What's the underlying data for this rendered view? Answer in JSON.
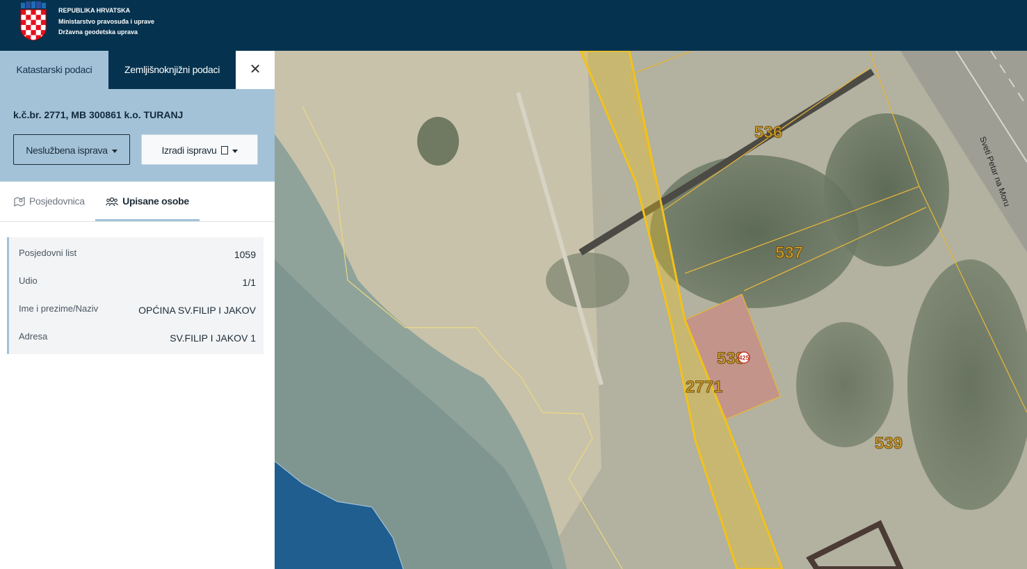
{
  "header": {
    "org_line1": "REPUBLIKA HRVATSKA",
    "org_line2": "Ministarstvo pravosuđa i uprave",
    "org_line3": "Državna geodetska uprava"
  },
  "panel": {
    "tabs": {
      "katastarski": "Katastarski podaci",
      "zemljisnoknjizni": "Zemljišnoknjižni podaci",
      "close": "✕"
    },
    "parcel_title": "k.č.br. 2771, MB 300861 k.o. TURANJ",
    "buttons": {
      "nesluzbena": "Neslužbena isprava",
      "izradi": "Izradi ispravu"
    },
    "subtabs": {
      "posjedovnica": "Posjedovnica",
      "upisane": "Upisane osobe"
    },
    "owner_rows": [
      {
        "label": "Posjedovni list",
        "value": "1059"
      },
      {
        "label": "Udio",
        "value": "1/1"
      },
      {
        "label": "Ime i prezime/Naziv",
        "value": "OPĆINA SV.FILIP I JAKOV"
      },
      {
        "label": "Adresa",
        "value": "SV.FILIP I JAKOV 1"
      }
    ]
  },
  "map": {
    "parcels": [
      "536",
      "537",
      "538",
      "539",
      "2771"
    ],
    "house_number": "425",
    "street_name": "Sveti Petar na Moru",
    "colors": {
      "parcel_line": "#e6b43a",
      "selected": "#f2c21b",
      "sea": "#1f5e8e"
    }
  }
}
